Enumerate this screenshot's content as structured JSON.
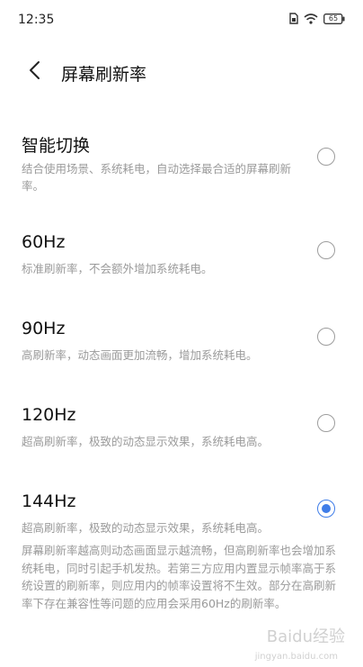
{
  "status_bar": {
    "time": "12:35",
    "icons": [
      "sim-icon",
      "wifi-icon",
      "battery-icon"
    ],
    "battery_text": "65"
  },
  "header": {
    "back_icon": "chevron-left-icon",
    "title": "屏幕刷新率"
  },
  "options": [
    {
      "title": "智能切换",
      "desc": "结合使用场景、系统耗电，自动选择最合适的屏幕刷新率。",
      "selected": false
    },
    {
      "title": "60Hz",
      "desc": "标准刷新率，不会额外增加系统耗电。",
      "selected": false
    },
    {
      "title": "90Hz",
      "desc": "高刷新率，动态画面更加流畅，增加系统耗电。",
      "selected": false
    },
    {
      "title": "120Hz",
      "desc": "超高刷新率，极致的动态显示效果，系统耗电高。",
      "selected": false
    },
    {
      "title": "144Hz",
      "desc": "超高刷新率，极致的动态显示效果，系统耗电高。",
      "selected": true
    }
  ],
  "footer_note": "屏幕刷新率越高则动态画面显示越流畅，但高刷新率也会增加系统耗电，同时引起手机发热。若第三方应用内置显示帧率高于系统设置的刷新率，则应用内的帧率设置将不生效。部分在高刷新率下存在兼容性等问题的应用会采用60Hz的刷新率。",
  "watermark": {
    "main": "Baidu经验",
    "sub": "jingyan.baidu.com"
  },
  "colors": {
    "accent": "#3f7de8",
    "secondary_text": "#9a9a9a"
  }
}
